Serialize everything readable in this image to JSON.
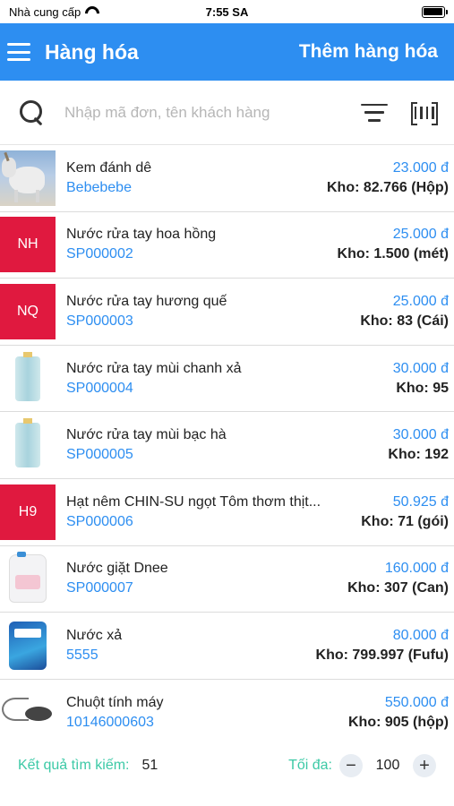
{
  "status_bar": {
    "carrier": "Nhà cung cấp",
    "time": "7:55 SA"
  },
  "header": {
    "title": "Hàng hóa",
    "action": "Thêm hàng hóa"
  },
  "search": {
    "placeholder": "Nhập mã đơn, tên khách hàng"
  },
  "products": [
    {
      "name": "Kem đánh dê",
      "code": "Bebebebe",
      "price": "23.000 đ",
      "stock": "Kho: 82.766 (Hộp)",
      "thumb": "image"
    },
    {
      "name": "Nước rửa tay hoa hồng",
      "code": "SP000002",
      "price": "25.000 đ",
      "stock": "Kho: 1.500 (mét)",
      "thumb": "NH"
    },
    {
      "name": "Nước rửa tay hương quế",
      "code": "SP000003",
      "price": "25.000 đ",
      "stock": "Kho: 83 (Cái)",
      "thumb": "NQ"
    },
    {
      "name": "Nước rửa tay mùi chanh xả",
      "code": "SP000004",
      "price": "30.000 đ",
      "stock": "Kho: 95",
      "thumb": "image"
    },
    {
      "name": "Nước rửa tay mùi bạc hà",
      "code": "SP000005",
      "price": "30.000 đ",
      "stock": "Kho: 192",
      "thumb": "image"
    },
    {
      "name": "Hạt nêm CHIN-SU ngọt Tôm thơm thịt...",
      "code": "SP000006",
      "price": "50.925 đ",
      "stock": "Kho: 71 (gói)",
      "thumb": "H9"
    },
    {
      "name": "Nước giặt Dnee",
      "code": "SP000007",
      "price": "160.000 đ",
      "stock": "Kho: 307 (Can)",
      "thumb": "image"
    },
    {
      "name": "Nước xả",
      "code": "5555",
      "price": "80.000 đ",
      "stock": "Kho: 799.997 (Fufu)",
      "thumb": "image"
    },
    {
      "name": "Chuột tính máy",
      "code": "10146000603",
      "price": "550.000 đ",
      "stock": "Kho: 905 (hộp)",
      "thumb": "image"
    }
  ],
  "footer": {
    "result_label": "Kết quả tìm kiếm:",
    "result_count": "51",
    "max_label": "Tối đa:",
    "max_value": "100",
    "minus": "−",
    "plus": "+"
  },
  "colors": {
    "primary": "#2d8ef1",
    "thumb_red": "#e0193f",
    "footer_label": "#3cc9a6"
  }
}
